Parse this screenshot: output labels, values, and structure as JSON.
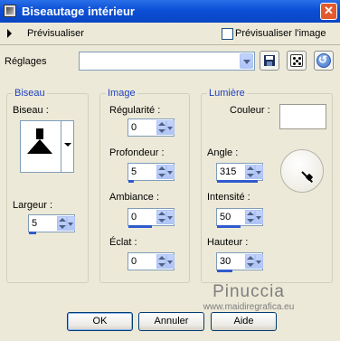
{
  "window": {
    "title": "Biseautage intérieur",
    "close_glyph": "✕"
  },
  "preview": {
    "label": "Prévisualiser",
    "checkbox_label": "Prévisualiser l'image",
    "checked": false
  },
  "presets": {
    "label": "Réglages",
    "value": ""
  },
  "icons": [
    "save-preset-icon",
    "random-dice-icon",
    "reset-icon",
    "bevel-shape-icon",
    "angle-dial-icon"
  ],
  "bevel_group": {
    "title": "Biseau",
    "bevel_label": "Biseau :",
    "width_label": "Largeur :",
    "width_value": "5"
  },
  "image_group": {
    "title": "Image",
    "smoothness_label": "Régularité :",
    "smoothness_value": "0",
    "depth_label": "Profondeur :",
    "depth_value": "5",
    "ambience_label": "Ambiance :",
    "ambience_value": "0",
    "shininess_label": "Éclat :",
    "shininess_value": "0"
  },
  "light_group": {
    "title": "Lumière",
    "color_label": "Couleur :",
    "color_value": "#FFFFFF",
    "angle_label": "Angle :",
    "angle_value": "315",
    "intensity_label": "Intensité :",
    "intensity_value": "50",
    "elevation_label": "Hauteur :",
    "elevation_value": "30"
  },
  "watermark": {
    "name": "Pinuccia",
    "url": "www.maidiregrafica.eu"
  },
  "buttons": {
    "ok": "OK",
    "cancel": "Annuler",
    "help": "Aide"
  },
  "colors": {
    "titlebar": "#0B4FD6",
    "dialog_bg": "#ECE9D8",
    "group_title": "#1F3FBE",
    "slider_fill": "#2F5BCE"
  }
}
